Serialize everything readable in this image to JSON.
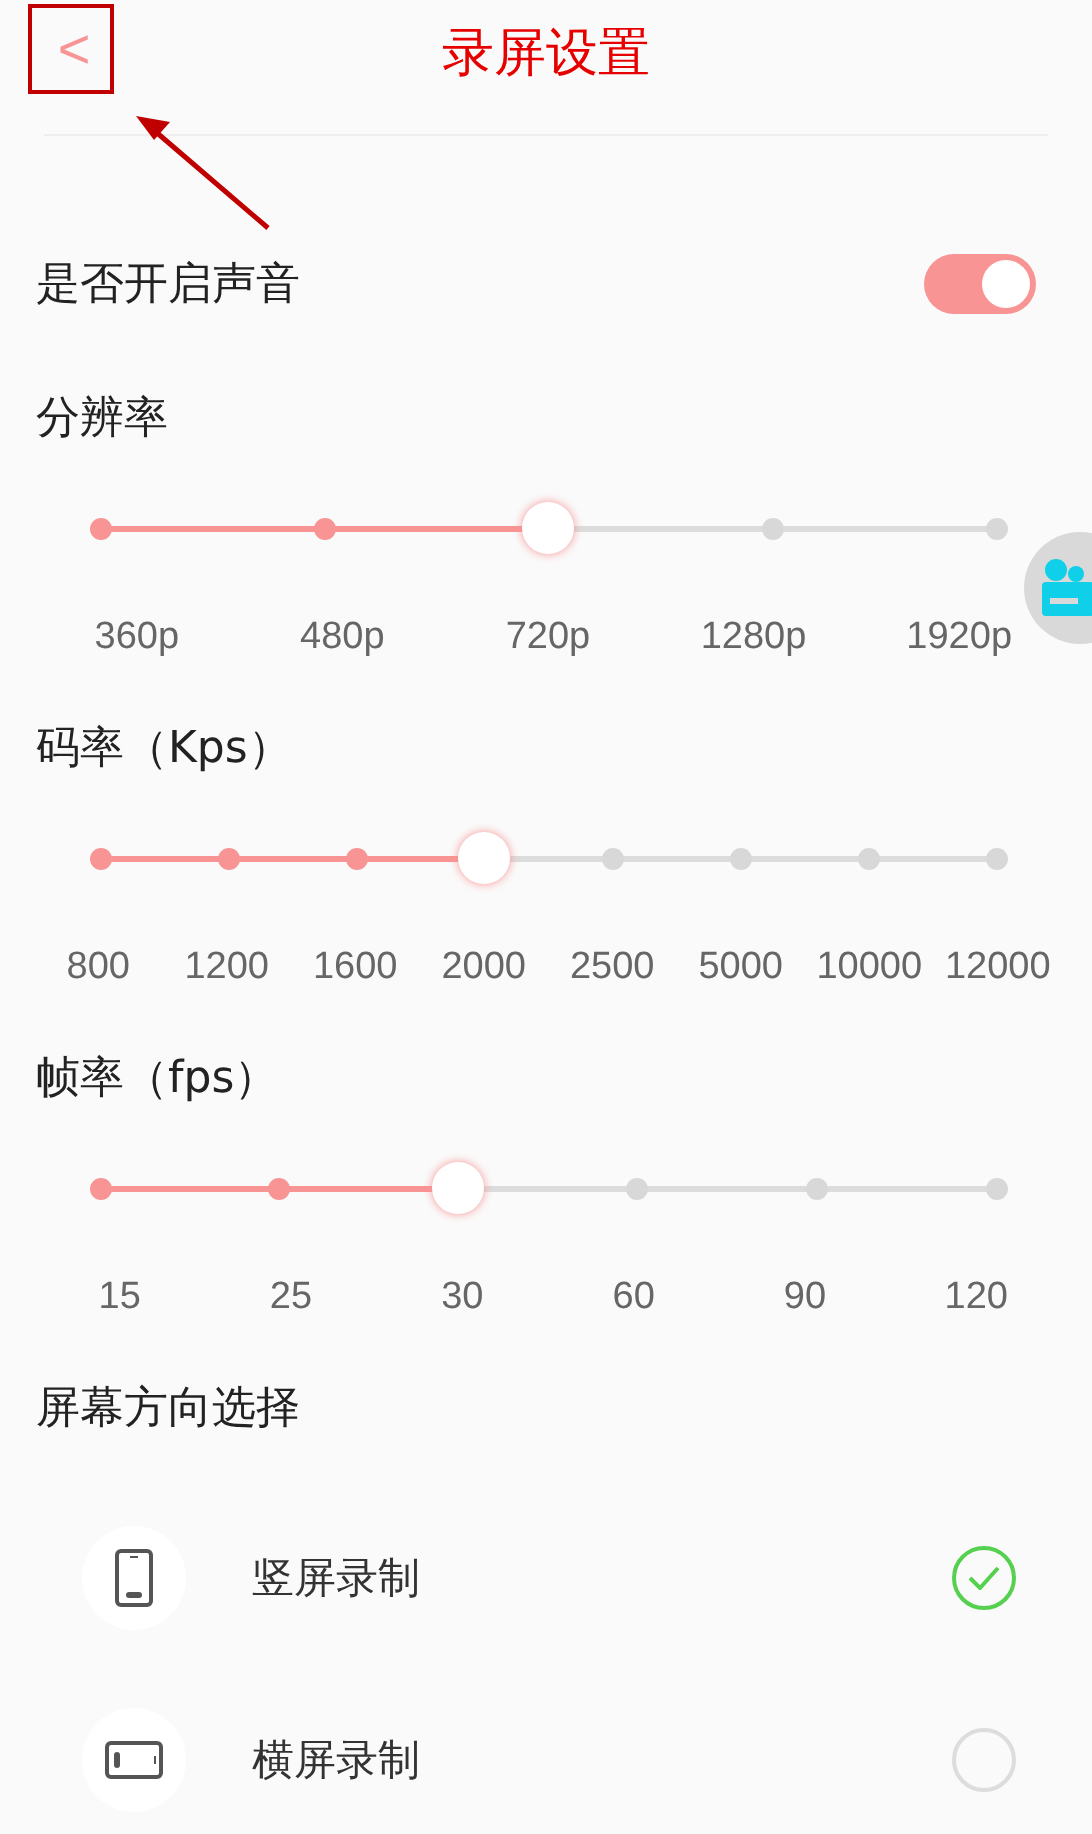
{
  "header": {
    "back": "<",
    "title": "录屏设置"
  },
  "sound": {
    "label": "是否开启声音",
    "on": true
  },
  "sliders": [
    {
      "label": "分辨率",
      "options": [
        {
          "label": "360p",
          "selected": false
        },
        {
          "label": "480p",
          "selected": false
        },
        {
          "label": "720p",
          "selected": true
        },
        {
          "label": "1280p",
          "selected": false
        },
        {
          "label": "1920p",
          "selected": false
        }
      ]
    },
    {
      "label": "码率（Kps）",
      "options": [
        {
          "label": "800",
          "selected": false
        },
        {
          "label": "1200",
          "selected": false
        },
        {
          "label": "1600",
          "selected": false
        },
        {
          "label": "2000",
          "selected": true
        },
        {
          "label": "2500",
          "selected": false
        },
        {
          "label": "5000",
          "selected": false
        },
        {
          "label": "10000",
          "selected": false
        },
        {
          "label": "12000",
          "selected": false
        }
      ]
    },
    {
      "label": "帧率（fps）",
      "options": [
        {
          "label": "15",
          "selected": false
        },
        {
          "label": "25",
          "selected": false
        },
        {
          "label": "30",
          "selected": true
        },
        {
          "label": "60",
          "selected": false
        },
        {
          "label": "90",
          "selected": false
        },
        {
          "label": "120",
          "selected": false
        }
      ]
    }
  ],
  "orientation": {
    "label": "屏幕方向选择",
    "options": [
      {
        "kind": "portrait",
        "label": "竖屏录制",
        "selected": true
      },
      {
        "kind": "landscape",
        "label": "横屏录制",
        "selected": false
      }
    ]
  }
}
